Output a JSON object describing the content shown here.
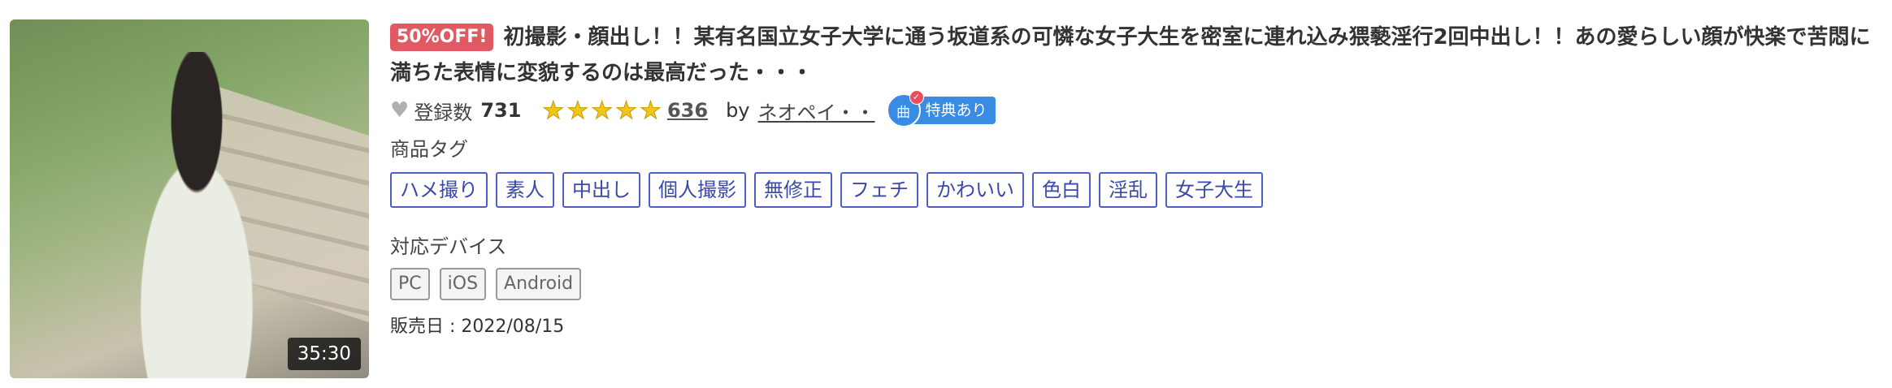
{
  "thumbnail": {
    "duration": "35:30"
  },
  "title": {
    "sale_badge": "50%OFF!",
    "text": "初撮影・顔出し！！某有名国立女子大学に通う坂道系の可憐な女子大生を密室に連れ込み猥褻淫行2回中出し！！あの愛らしい顔が快楽で苦悶に満ちた表情に変貌するのは最高だった・・・"
  },
  "meta": {
    "favorites_label": "登録数",
    "favorites_count": "731",
    "rating_stars": 5,
    "rating_count": "636",
    "by_label": "by",
    "author": "ネオペイ・・",
    "bonus_label": "特典あり",
    "bonus_icon_text": "曲",
    "bonus_dot": "✓"
  },
  "tags_section": {
    "title": "商品タグ",
    "tags": [
      "ハメ撮り",
      "素人",
      "中出し",
      "個人撮影",
      "無修正",
      "フェチ",
      "かわいい",
      "色白",
      "淫乱",
      "女子大生"
    ]
  },
  "devices_section": {
    "title": "対応デバイス",
    "devices": [
      "PC",
      "iOS",
      "Android"
    ]
  },
  "release": "販売日 : 2022/08/15",
  "colors": {
    "sale": "#e05a64",
    "tag_border": "#4f5fc8",
    "bonus": "#3a8be2",
    "star": "#f2c518"
  }
}
